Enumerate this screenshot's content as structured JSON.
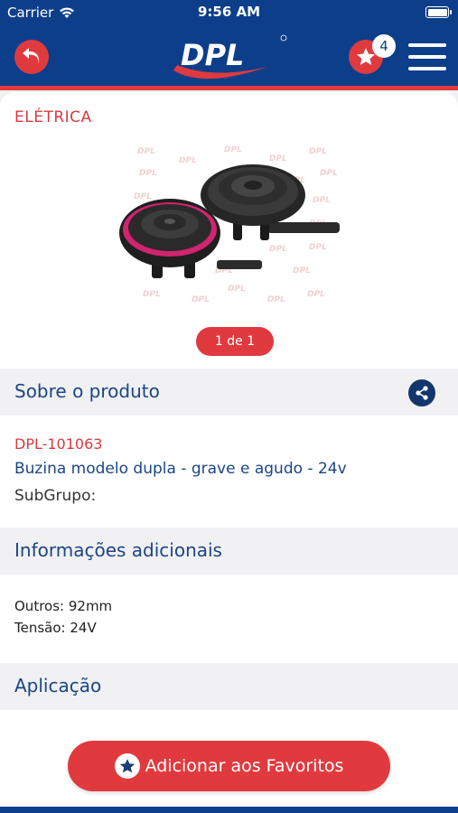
{
  "status_bar": {
    "carrier": "Carrier",
    "time": "9:56 AM",
    "wifi_icon": "wifi-icon",
    "battery_icon": "battery-icon"
  },
  "header": {
    "logo_text": "DPL",
    "back_icon": "back-arrow-icon",
    "favorites_icon": "star-icon",
    "favorites_count": "4",
    "menu_icon": "hamburger-menu-icon",
    "colors": {
      "primary": "#0d3e8a",
      "accent": "#e03a3e"
    }
  },
  "product": {
    "category": "ELÉTRICA",
    "pager": "1 de 1",
    "code": "DPL-101063",
    "name": "Buzina modelo dupla - grave e agudo - 24v",
    "subgroup_label": "SubGrupo:"
  },
  "sections": {
    "about": "Sobre o produto",
    "additional_info": "Informações adicionais",
    "application": "Aplicação",
    "share_icon": "share-icon"
  },
  "additional_info": [
    {
      "label": "Outros:",
      "value": "92mm"
    },
    {
      "label": "Tensão:",
      "value": "24V"
    }
  ],
  "add_favorites_label": "Adicionar aos Favoritos"
}
